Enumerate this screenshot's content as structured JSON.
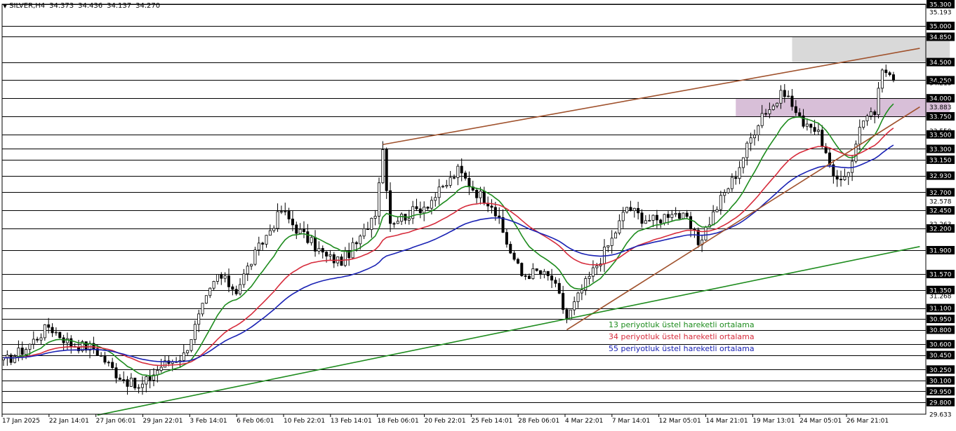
{
  "header": {
    "symbol_timeframe": "SILVER,H4",
    "open": "34.373",
    "high": "34.436",
    "low": "34.137",
    "close": "34.270"
  },
  "chart_data": {
    "type": "candlestick",
    "symbol": "SILVER",
    "timeframe": "H4",
    "ylim": [
      29.633,
      35.3
    ],
    "y_axis_ticks": [
      "35.300",
      "35.193",
      "35.000",
      "34.850",
      "34.500",
      "34.250",
      "34.213",
      "34.000",
      "33.883",
      "33.750",
      "33.550",
      "33.500",
      "33.300",
      "33.150",
      "32.930",
      "32.700",
      "32.578",
      "32.450",
      "32.263",
      "32.200",
      "31.900",
      "31.570",
      "31.350",
      "31.268",
      "31.100",
      "30.950",
      "30.800",
      "30.600",
      "30.450",
      "30.250",
      "30.100",
      "29.950",
      "29.800",
      "29.633"
    ],
    "highlighted_levels": [
      "35.300",
      "35.000",
      "34.850",
      "34.500",
      "34.250",
      "34.000",
      "33.750",
      "33.500",
      "33.300",
      "33.150",
      "32.930",
      "32.700",
      "32.450",
      "32.200",
      "31.900",
      "31.570",
      "31.350",
      "31.100",
      "30.950",
      "30.800",
      "30.600",
      "30.450",
      "30.250",
      "30.100",
      "29.950",
      "29.800"
    ],
    "current_price_label": "33.883",
    "x_tick_labels": [
      "17 Jan 2025",
      "22 Jan 14:01",
      "27 Jan 06:01",
      "29 Jan 22:01",
      "3 Feb 14:01",
      "6 Feb 06:01",
      "10 Feb 22:01",
      "13 Feb 14:01",
      "18 Feb 06:01",
      "20 Feb 22:01",
      "25 Feb 14:01",
      "28 Feb 06:01",
      "4 Mar 22:01",
      "7 Mar 14:01",
      "12 Mar 05:01",
      "14 Mar 21:01",
      "19 Mar 13:01",
      "24 Mar 05:01",
      "26 Mar 21:01"
    ],
    "price_path": [
      [
        0,
        30.35
      ],
      [
        6,
        30.55
      ],
      [
        12,
        30.85
      ],
      [
        18,
        30.6
      ],
      [
        24,
        30.55
      ],
      [
        30,
        30.2
      ],
      [
        36,
        29.98
      ],
      [
        42,
        30.3
      ],
      [
        48,
        30.45
      ],
      [
        53,
        31.1
      ],
      [
        57,
        31.55
      ],
      [
        62,
        31.35
      ],
      [
        66,
        31.75
      ],
      [
        70,
        32.1
      ],
      [
        74,
        32.45
      ],
      [
        78,
        32.2
      ],
      [
        82,
        32.0
      ],
      [
        86,
        31.8
      ],
      [
        90,
        31.75
      ],
      [
        95,
        32.05
      ],
      [
        99,
        32.45
      ],
      [
        101,
        33.3
      ],
      [
        103,
        32.3
      ],
      [
        108,
        32.4
      ],
      [
        113,
        32.55
      ],
      [
        117,
        32.75
      ],
      [
        121,
        33.0
      ],
      [
        126,
        32.7
      ],
      [
        130,
        32.55
      ],
      [
        134,
        32.0
      ],
      [
        138,
        31.55
      ],
      [
        142,
        31.6
      ],
      [
        146,
        31.5
      ],
      [
        148,
        31.25
      ],
      [
        150,
        30.95
      ],
      [
        154,
        31.35
      ],
      [
        158,
        31.7
      ],
      [
        162,
        32.05
      ],
      [
        166,
        32.5
      ],
      [
        170,
        32.35
      ],
      [
        174,
        32.3
      ],
      [
        178,
        32.45
      ],
      [
        182,
        32.3
      ],
      [
        185,
        32.0
      ],
      [
        188,
        32.3
      ],
      [
        191,
        32.6
      ],
      [
        195,
        32.95
      ],
      [
        199,
        33.45
      ],
      [
        202,
        33.8
      ],
      [
        205,
        33.9
      ],
      [
        208,
        34.1
      ],
      [
        212,
        33.7
      ],
      [
        215,
        33.65
      ],
      [
        218,
        33.4
      ],
      [
        221,
        32.85
      ],
      [
        224,
        32.95
      ],
      [
        226,
        33.1
      ],
      [
        228,
        33.65
      ],
      [
        230,
        33.7
      ],
      [
        232,
        33.8
      ],
      [
        234,
        34.35
      ],
      [
        236,
        34.4
      ],
      [
        237,
        34.3
      ]
    ],
    "ema_tails": {
      "ema13": 33.95,
      "ema34": 33.65,
      "ema55": 33.5
    },
    "legend": [
      {
        "label": "13 periyotluk üstel hareketli ortalama",
        "color": "#1e8c1e"
      },
      {
        "label": "34 periyotluk üstel hareketli ortalama",
        "color": "#d62c3c"
      },
      {
        "label": "55 periyotluk üstel hareketli ortalama",
        "color": "#1a22b4"
      }
    ],
    "trendlines": [
      {
        "name": "upper-resistance",
        "color": "#a0522d",
        "from": [
          101,
          33.36
        ],
        "to": [
          244,
          34.69
        ]
      },
      {
        "name": "rising-support",
        "color": "#a0522d",
        "from": [
          150,
          30.8
        ],
        "to": [
          244,
          33.88
        ]
      },
      {
        "name": "long-term-support",
        "color": "#1e8c1e",
        "from": [
          25,
          29.62
        ],
        "to": [
          244,
          31.95
        ]
      }
    ],
    "zones": [
      {
        "name": "supply-zone",
        "color": "#d9d9d9",
        "x": [
          210,
          252
        ],
        "y": [
          34.5,
          34.85
        ]
      },
      {
        "name": "breakout-zone",
        "color": "#d8bfd8",
        "x": [
          195,
          252
        ],
        "y": [
          33.75,
          34.0
        ]
      }
    ],
    "grid": false
  }
}
